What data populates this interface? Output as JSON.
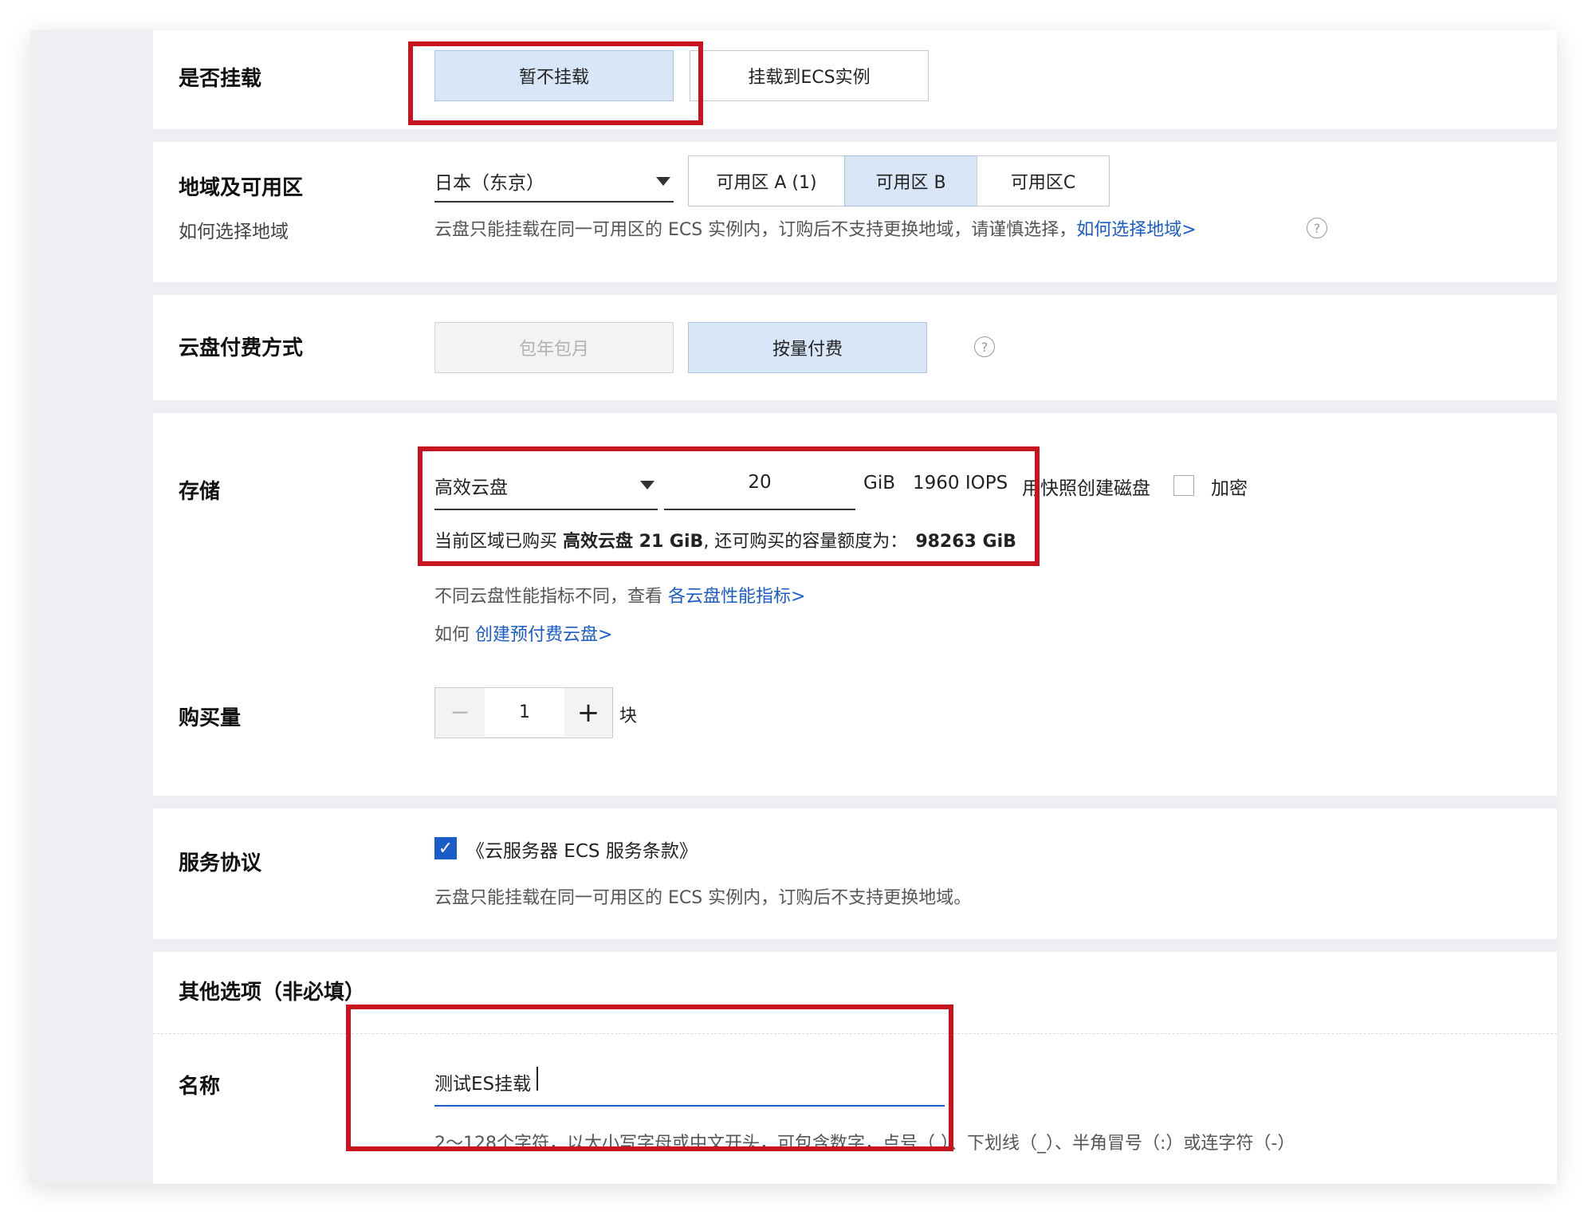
{
  "mount": {
    "label": "是否挂载",
    "options": [
      "暂不挂载",
      "挂载到ECS实例"
    ],
    "selected": "暂不挂载"
  },
  "region": {
    "label": "地域及可用区",
    "sublabel": "如何选择地域",
    "region_value": "日本（东京）",
    "zones": [
      "可用区 A (1)",
      "可用区 B",
      "可用区C"
    ],
    "selected_zone": "可用区 B",
    "hint": "云盘只能挂载在同一可用区的 ECS 实例内，订购后不支持更换地域，请谨慎选择，",
    "hint_link": "如何选择地域>",
    "help_icon": "question-circle-icon"
  },
  "billing": {
    "label": "云盘付费方式",
    "options": [
      "包年包月",
      "按量付费"
    ],
    "selected": "按量付费",
    "disabled": "包年包月"
  },
  "storage": {
    "label": "存储",
    "disk_type": "高效云盘",
    "size": "20",
    "unit": "GiB",
    "iops": "1960 IOPS",
    "snapshot_link": "用快照创建磁盘",
    "encrypt_label": "加密",
    "encrypt_checked": false,
    "quota_prefix": "当前区域已购买 ",
    "quota_bought": "高效云盘 21 GiB",
    "quota_mid": ", 还可购买的容量额度为：",
    "quota_left": "98263 GiB",
    "perf_hint": "不同云盘性能指标不同，查看 ",
    "perf_link": "各云盘性能指标>",
    "prepaid_prefix": "如何 ",
    "prepaid_link": "创建预付费云盘>"
  },
  "quantity": {
    "label": "购买量",
    "value": "1",
    "unit": "块",
    "minus": "−",
    "plus": "+"
  },
  "agreement": {
    "label": "服务协议",
    "checked": true,
    "link": "《云服务器 ECS 服务条款》",
    "hint": "云盘只能挂载在同一可用区的 ECS 实例内，订购后不支持更换地域。"
  },
  "other": {
    "title": "其他选项（非必填）",
    "name_label": "名称",
    "name_value": "测试ES挂载",
    "name_hint": "2～128个字符，以大小写字母或中文开头，可包含数字，点号（.）、下划线（_）、半角冒号（:）或连字符（-）"
  },
  "colors": {
    "accent": "#1a5dc8",
    "selected_bg": "#d9e6f8",
    "highlight_red": "#c8141e"
  }
}
